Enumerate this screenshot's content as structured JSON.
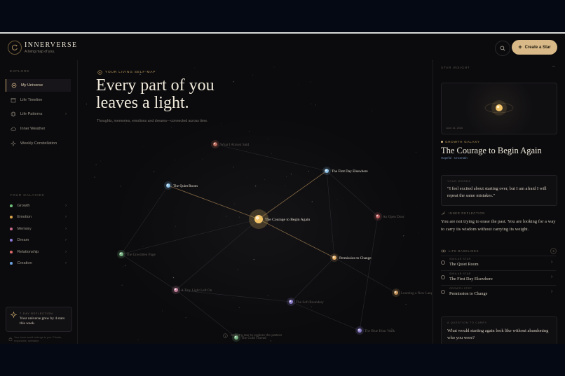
{
  "brand": {
    "name": "INNERVERSE",
    "tagline": "A living map of you.",
    "create_label": "Create a Star"
  },
  "sidebar": {
    "explore_label": "EXPLORE",
    "nav": [
      {
        "label": "My Universe",
        "icon": "orbit-icon",
        "active": true
      },
      {
        "label": "Life Timeline",
        "icon": "calendar-icon"
      },
      {
        "label": "Life Patterns",
        "icon": "globe-icon"
      },
      {
        "label": "Inner Weather",
        "icon": "weather-icon"
      },
      {
        "label": "Weekly Constellation",
        "icon": "constellation-icon"
      }
    ],
    "galaxies_label": "YOUR GALAXIES",
    "galaxies": [
      {
        "label": "Growth",
        "color": "#6fbf7a"
      },
      {
        "label": "Emotion",
        "color": "#d9a24a"
      },
      {
        "label": "Memory",
        "color": "#c56a8a"
      },
      {
        "label": "Dream",
        "color": "#8f7bd8"
      },
      {
        "label": "Relationship",
        "color": "#d96a6a"
      },
      {
        "label": "Creation",
        "color": "#6aa0d9"
      }
    ],
    "reflection": {
      "label": "7-DAY REFLECTION",
      "text": "Your universe grew by 4 stars this week."
    },
    "footer": "Your inner world belongs to you. Private, exportable, deletable."
  },
  "map": {
    "eyebrow": "YOUR LIVING SELF-MAP",
    "title_line1": "Every part of you",
    "title_line2": "leaves a light.",
    "subtitle": "Thoughts, memories, emotions and dreams—connected across time.",
    "hint": "Select a star to explore the pattern",
    "stars": [
      {
        "id": "what",
        "label": "What I Almost Said",
        "color": "#d97a6a",
        "dim": true
      },
      {
        "id": "quiet",
        "label": "The Quiet Room",
        "color": "#8fc3e8",
        "dim": false
      },
      {
        "id": "first",
        "label": "The First Day Elsewhere",
        "color": "#8fc3e8",
        "dim": false
      },
      {
        "id": "courage",
        "label": "The Courage to Begin Again",
        "color": "#f2c46a",
        "dim": false,
        "focus": true
      },
      {
        "id": "open",
        "label": "An Open Door",
        "color": "#d96a6a",
        "dim": true
      },
      {
        "id": "unwritten",
        "label": "The Unwritten Page",
        "color": "#8fd39a",
        "dim": true
      },
      {
        "id": "permission",
        "label": "Permission to Change",
        "color": "#e8b06a",
        "dim": false
      },
      {
        "id": "tiny",
        "label": "A Tiny Light Left On",
        "color": "#e89ab8",
        "dim": true
      },
      {
        "id": "soft",
        "label": "The Soft Boundary",
        "color": "#a896f0",
        "dim": true
      },
      {
        "id": "learning",
        "label": "Learning a New Lang...",
        "color": "#e8b06a",
        "dim": true
      },
      {
        "id": "gold",
        "label": "The Gold Thread",
        "color": "#8fd39a",
        "dim": true
      },
      {
        "id": "blue",
        "label": "The Blue Hour Walk",
        "color": "#a896f0",
        "dim": true
      }
    ]
  },
  "panel": {
    "header": "STAR INSIGHT",
    "date": "June 14, 2026",
    "galaxy": "GROWTH GALAXY",
    "title": "The Courage to Begin Again",
    "mood": "Hopeful · Uncertain",
    "words_label": "YOUR WORDS",
    "words": "“I feel excited about starting over, but I am afraid I will repeat the same mistakes.”",
    "reflection_label": "INNER REFLECTION",
    "reflection": "You are not trying to erase the past. You are looking for a way to carry its wisdom without carrying its weight.",
    "lines_label": "LIFE BASELINES",
    "lines_count": "3",
    "lines": [
      {
        "kind": "SIMILAR STAR",
        "name": "The Quiet Room"
      },
      {
        "kind": "SIMILAR STAR",
        "name": "The First Day Elsewhere"
      },
      {
        "kind": "GROWTH STEP",
        "name": "Permission to Change"
      }
    ],
    "carry_label": "A QUESTION TO CARRY",
    "carry": "What would starting again look like without abandoning who you were?"
  }
}
